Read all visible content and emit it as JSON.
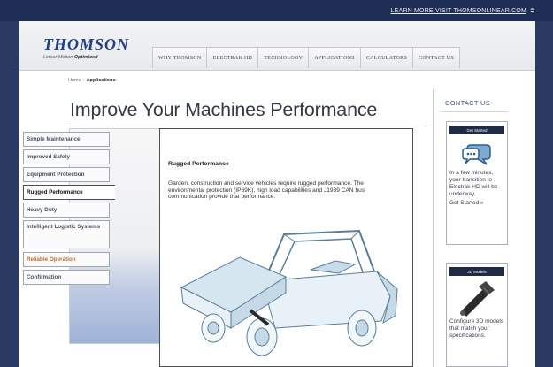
{
  "topbar": {
    "link_text": "LEARN MORE VISIT THOMSONLINEAR.COM",
    "arrow": "➲"
  },
  "brand": {
    "name": "THOMSON",
    "tagline_prefix": "Linear Motion",
    "tagline_suffix": "Optimized"
  },
  "nav": [
    "WHY THOMSON",
    "ELECTRAK HD",
    "TECHNOLOGY",
    "APPLICATIONS",
    "CALCULATORS",
    "CONTACT US"
  ],
  "breadcrumb": {
    "home": "Home",
    "sep": "›",
    "current": "Applications"
  },
  "page_title": "Improve Your Machines Performance",
  "tabs": [
    {
      "label": "Simple Maintenance"
    },
    {
      "label": "Improved Safety"
    },
    {
      "label": "Equipment Protection"
    },
    {
      "label": "Rugged Performance",
      "active": true
    },
    {
      "label": "Heavy Duty"
    },
    {
      "label": "Intelligent Logistic Systems"
    },
    {
      "label": "Reliable Operation"
    },
    {
      "label": "Confirmation"
    }
  ],
  "content": {
    "heading": "Rugged Performance",
    "body": "Garden, construction and service vehicles require rugged performance. The environmental protection (IP69K), high load capabilities and J1939 CAN bus communication provide that performance."
  },
  "sidebar": {
    "contact_heading": "CONTACT US",
    "get_started": {
      "badge": "Get Started",
      "text": "In a few minutes, your transition to Electrak HD will be underway.",
      "link": "Get Started »"
    },
    "models_3d": {
      "badge": "3D Models",
      "text": "Configure 3D models that match your specifications."
    }
  },
  "colors": {
    "brand_blue": "#1e3f8a",
    "accent_orange": "#c36a2a",
    "badge_dark": "#1f2a44"
  }
}
